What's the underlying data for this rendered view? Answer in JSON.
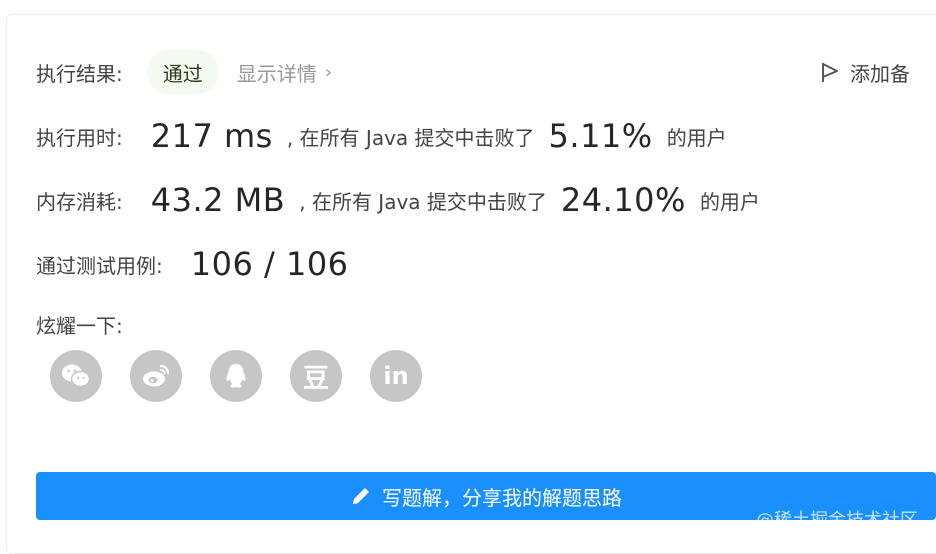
{
  "result": {
    "label": "执行结果:",
    "status": "通过",
    "details_link": "显示详情",
    "add_note": "添加备"
  },
  "runtime": {
    "label": "执行用时:",
    "value": "217 ms",
    "text": ", 在所有 Java 提交中击败了",
    "percent": "5.11%",
    "suffix": "的用户"
  },
  "memory": {
    "label": "内存消耗:",
    "value": "43.2 MB",
    "text": ", 在所有 Java 提交中击败了",
    "percent": "24.10%",
    "suffix": "的用户"
  },
  "tests": {
    "label": "通过测试用例:",
    "value": "106 / 106"
  },
  "share": {
    "label": "炫耀一下:",
    "icons": [
      "wechat-icon",
      "weibo-icon",
      "qq-icon",
      "douban-icon",
      "linkedin-icon"
    ],
    "douban_glyph": "豆",
    "linkedin_glyph": "in"
  },
  "write_solution": {
    "label": "写题解，分享我的解题思路"
  },
  "watermark": "@稀土掘金技术社区",
  "colors": {
    "primary": "#1a90ff",
    "pass_bg": "#f3faf0",
    "icon_gray": "#c6c6c6"
  }
}
